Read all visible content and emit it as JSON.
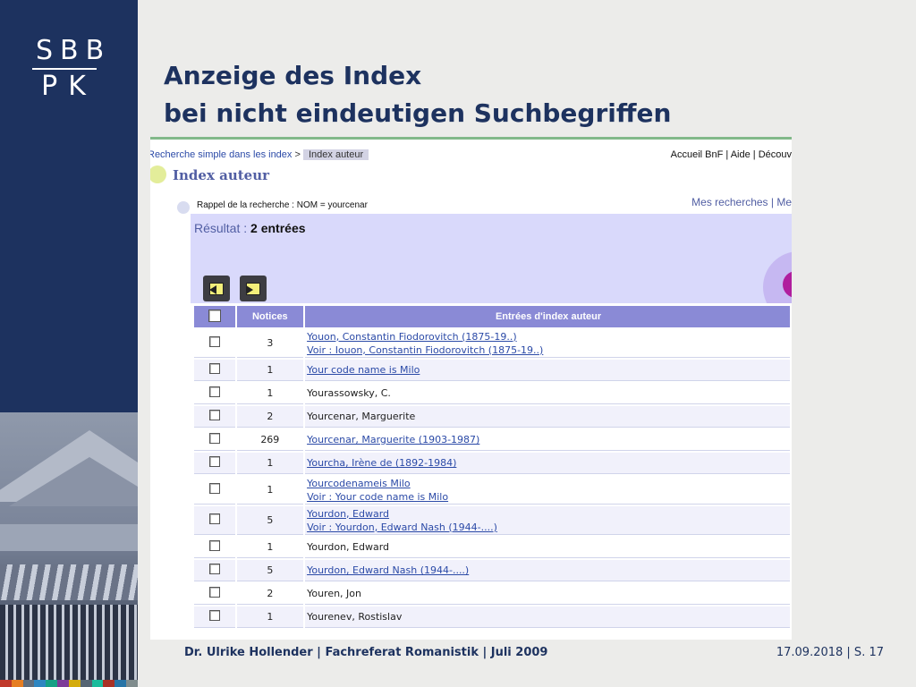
{
  "logo": {
    "top": "SBB",
    "bottom": "PK"
  },
  "title": {
    "line1": "Anzeige des Index",
    "line2": "bei nicht eindeutigen Suchbegriffen"
  },
  "browser": {
    "breadcrumb": {
      "link": "Recherche simple dans les index",
      "separator": ">",
      "current": "Index auteur"
    },
    "top_links": "Accueil BnF | Aide | Découv",
    "page_title": "Index auteur",
    "rappel": "Rappel de la recherche : NOM = yourcenar",
    "mes_recherches": "Mes recherches | Me",
    "result_label": "Résultat :",
    "result_value": "2 entrées",
    "table": {
      "col_notices": "Notices",
      "col_entries": "Entrées d'index auteur",
      "rows": [
        {
          "notices": "3",
          "lines": [
            {
              "text": "Youon, Constantin Fiodorovitch (1875-19..)",
              "link": true
            },
            {
              "text": "Voir : Iouon, Constantin Fiodorovitch (1875-19..)",
              "link": true
            }
          ]
        },
        {
          "notices": "1",
          "lines": [
            {
              "text": "Your code name is Milo",
              "link": true
            }
          ]
        },
        {
          "notices": "1",
          "lines": [
            {
              "text": "Yourassowsky, C.",
              "link": false
            }
          ]
        },
        {
          "notices": "2",
          "lines": [
            {
              "text": "Yourcenar, Marguerite",
              "link": false
            }
          ]
        },
        {
          "notices": "269",
          "lines": [
            {
              "text": "Yourcenar, Marguerite (1903-1987)",
              "link": true
            }
          ]
        },
        {
          "notices": "1",
          "lines": [
            {
              "text": "Yourcha, Irène de (1892-1984)",
              "link": true
            }
          ]
        },
        {
          "notices": "1",
          "lines": [
            {
              "text": "Yourcodenameis Milo",
              "link": true
            },
            {
              "text": "Voir : Your code name is Milo",
              "link": true
            }
          ]
        },
        {
          "notices": "5",
          "lines": [
            {
              "text": "Yourdon, Edward",
              "link": true
            },
            {
              "text": "Voir : Yourdon, Edward Nash (1944-....)",
              "link": true
            }
          ]
        },
        {
          "notices": "1",
          "lines": [
            {
              "text": "Yourdon, Edward",
              "link": false
            }
          ]
        },
        {
          "notices": "5",
          "lines": [
            {
              "text": "Yourdon, Edward Nash (1944-....)",
              "link": true
            }
          ]
        },
        {
          "notices": "2",
          "lines": [
            {
              "text": "Youren, Jon",
              "link": false
            }
          ]
        },
        {
          "notices": "1",
          "lines": [
            {
              "text": "Yourenev, Rostislav",
              "link": false
            }
          ]
        }
      ]
    }
  },
  "footer": {
    "left": "Dr. Ulrike Hollender | Fachreferat Romanistik | Juli 2009",
    "right": "17.09.2018 | S. 17"
  },
  "colors": {
    "brand_navy": "#1d325f",
    "table_header": "#8a8ad6",
    "panel_lavender": "#d9d9fb",
    "link_blue": "#2b4aa7",
    "stripe": [
      "#c0392b",
      "#e67e22",
      "#5d6d7e",
      "#2e86c1",
      "#16a085",
      "#7d3c98",
      "#d4ac0d",
      "#566573",
      "#1abc9c",
      "#a93226",
      "#2874a6",
      "#7f8c8d"
    ]
  },
  "icons": {
    "prev": "page-prev-icon",
    "next": "page-next-icon"
  }
}
